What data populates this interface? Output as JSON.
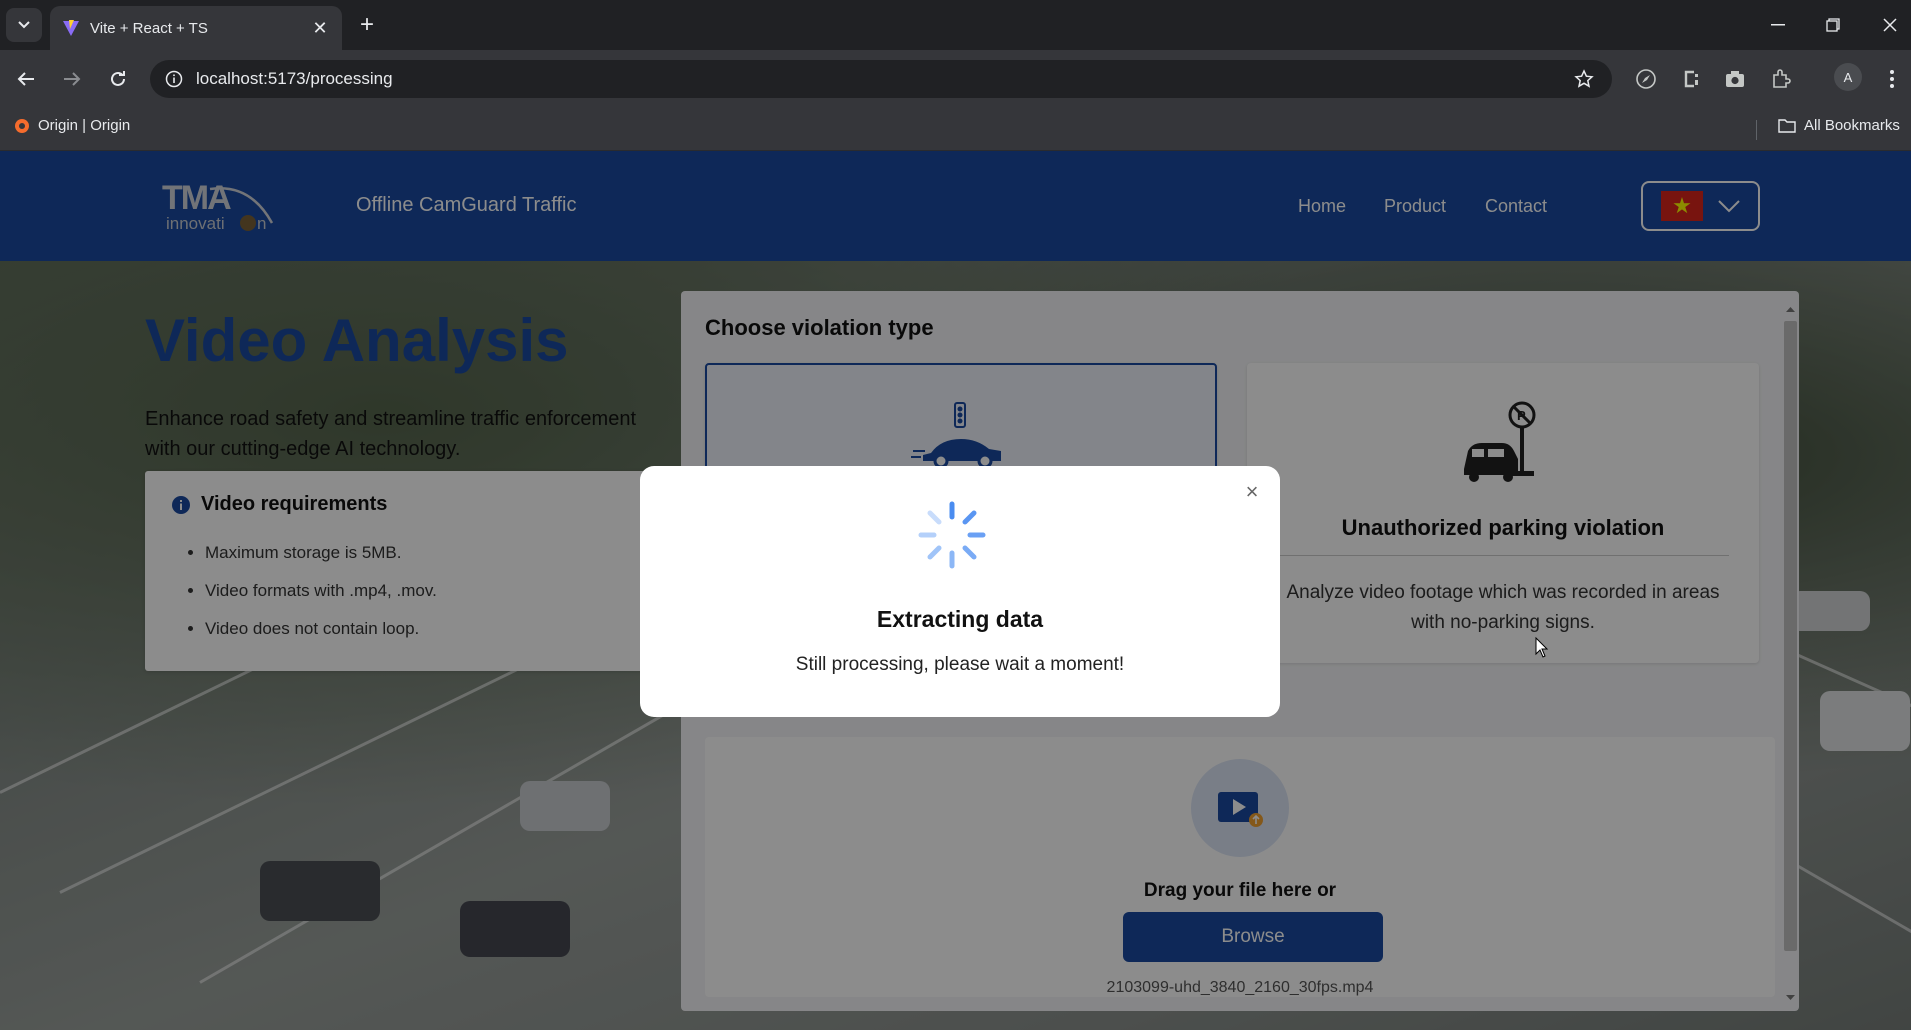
{
  "browser": {
    "tab_title": "Vite + React + TS",
    "url": "localhost:5173/processing",
    "bookmark_item": "Origin | Origin",
    "all_bookmarks": "All Bookmarks",
    "profile_initial": "A"
  },
  "header": {
    "logo_text": "TMA",
    "logo_subtext": "innovation",
    "app_title": "Offline CamGuard Traffic",
    "nav": [
      "Home",
      "Product",
      "Contact"
    ],
    "language_flag": "vietnam-flag"
  },
  "hero": {
    "title": "Video Analysis",
    "lead": "Enhance road safety and streamline traffic enforcement with our cutting-edge AI technology."
  },
  "requirements": {
    "title": "Video requirements",
    "items": [
      "Maximum storage is 5MB.",
      "Video formats with .mp4, .mov.",
      "Video does not contain loop."
    ]
  },
  "violation": {
    "heading": "Choose violation type",
    "cards": [
      {
        "title": "",
        "description": "",
        "icon": "traffic-light-car-icon",
        "selected": true
      },
      {
        "title": "Unauthorized parking violation",
        "description": "Analyze video footage which was recorded in areas with no-parking signs.",
        "icon": "no-parking-car-icon",
        "selected": false
      }
    ]
  },
  "upload": {
    "prompt": "Drag your file here or",
    "button": "Browse",
    "filename": "2103099-uhd_3840_2160_30fps.mp4"
  },
  "modal": {
    "title": "Extracting data",
    "message": "Still processing, please wait a moment!",
    "close": "×"
  },
  "colors": {
    "brand": "#1a4aa0",
    "chrome_dark": "#202124",
    "chrome": "#35363a"
  }
}
